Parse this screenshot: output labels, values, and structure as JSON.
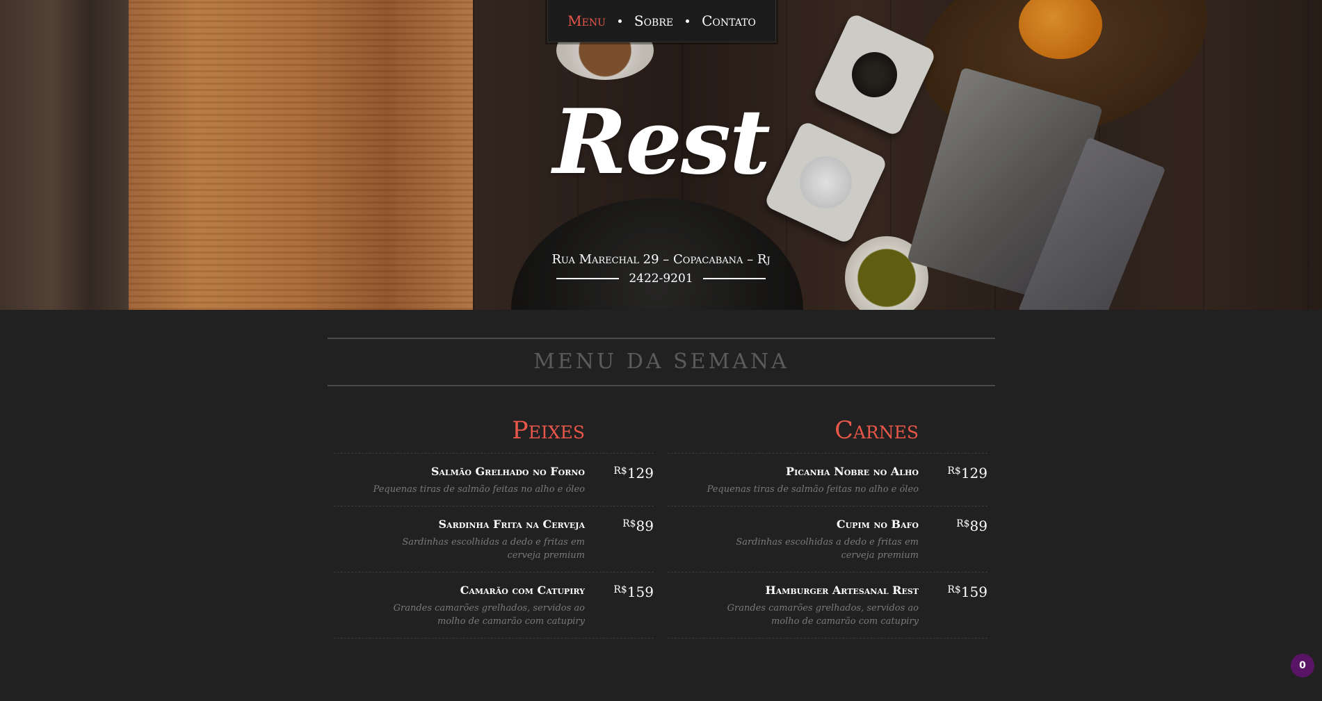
{
  "nav": {
    "items": [
      "Menu",
      "Sobre",
      "Contato"
    ]
  },
  "hero": {
    "logo": "Rest",
    "address": "Rua Marechal 29 – Copacabana – Rj",
    "phone": "2422-9201"
  },
  "menu": {
    "title": "MENU DA SEMANA",
    "currency": "R$",
    "columns": [
      {
        "title": "Peixes",
        "items": [
          {
            "name": "Salmão Grelhado no Forno",
            "desc": "Pequenas tiras de salmão feitas no alho e óleo",
            "price": "129"
          },
          {
            "name": "Sardinha Frita na Cerveja",
            "desc": "Sardinhas escolhidas a dedo e fritas em cerveja premium",
            "price": "89"
          },
          {
            "name": "Camarão com Catupiry",
            "desc": "Grandes camarões grelhados, servidos ao molho de camarão com catupiry",
            "price": "159"
          }
        ]
      },
      {
        "title": "Carnes",
        "items": [
          {
            "name": "Picanha Nobre no Alho",
            "desc": "Pequenas tiras de salmão feitas no alho e óleo",
            "price": "129"
          },
          {
            "name": "Cupim no Bafo",
            "desc": "Sardinhas escolhidas a dedo e fritas em cerveja premium",
            "price": "89"
          },
          {
            "name": "Hamburger Artesanal Rest",
            "desc": "Grandes camarões grelhados, servidos ao molho de camarão com catupiry",
            "price": "159"
          }
        ]
      }
    ]
  },
  "badge": {
    "count": "0"
  },
  "colors": {
    "accent": "#e8574a",
    "background": "#212121",
    "badge": "#5a1465"
  }
}
